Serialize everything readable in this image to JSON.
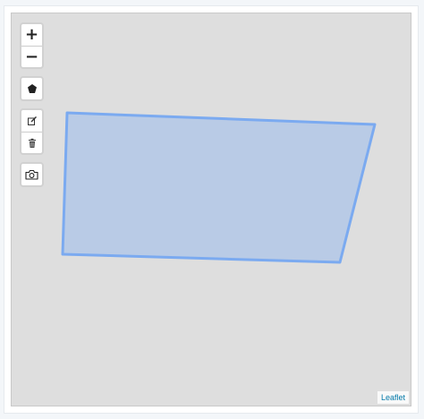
{
  "map": {
    "background_color": "#dedede",
    "attribution": "Leaflet"
  },
  "controls": {
    "zoom_in_label": "+",
    "zoom_out_label": "−",
    "draw_polygon_icon": "pentagon-icon",
    "edit_icon": "edit-icon",
    "delete_icon": "trash-icon",
    "screenshot_icon": "camera-icon"
  },
  "polygon": {
    "stroke_color": "#7baaf0",
    "fill_color": "#b9cbe6"
  }
}
